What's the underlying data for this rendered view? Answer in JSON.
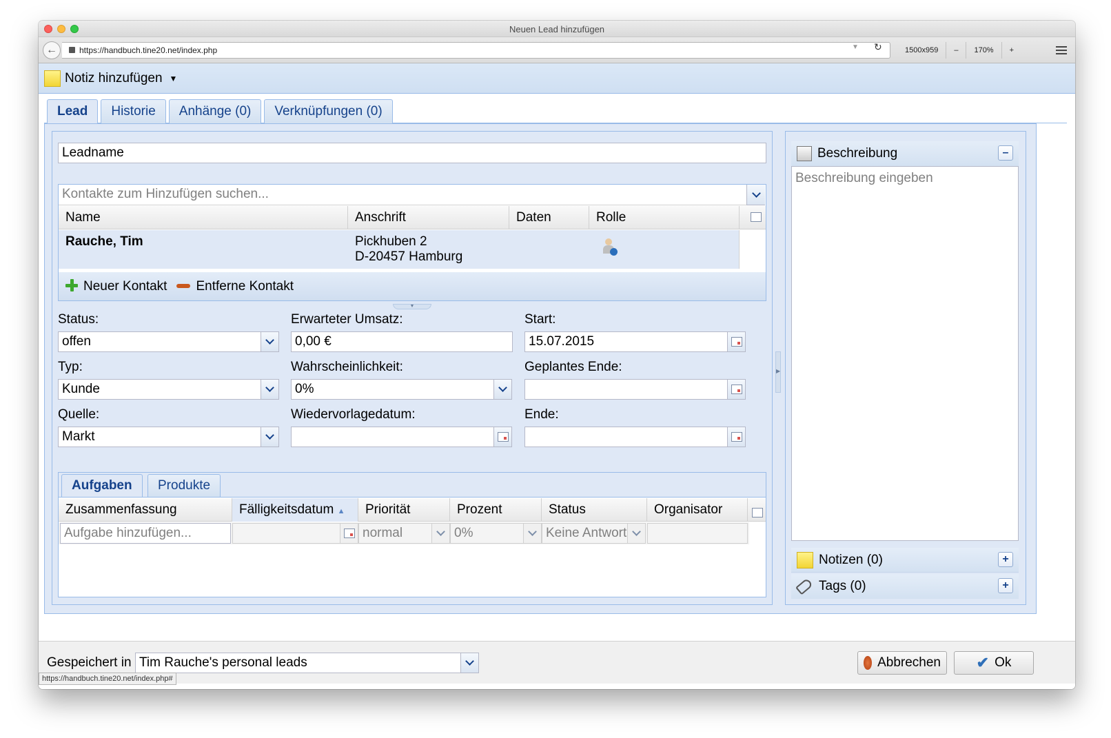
{
  "window": {
    "title": "Neuen Lead hinzufügen",
    "url": "https://handbuch.tine20.net/index.php",
    "viewport": "1500x959",
    "zoom_minus": "–",
    "zoom": "170%",
    "zoom_plus": "+"
  },
  "toolbar": {
    "add_note_label": "Notiz hinzufügen"
  },
  "tabs": [
    {
      "label": "Lead"
    },
    {
      "label": "Historie"
    },
    {
      "label": "Anhänge (0)"
    },
    {
      "label": "Verknüpfungen (0)"
    }
  ],
  "lead": {
    "name_placeholder": "Leadname",
    "contacts_search_placeholder": "Kontakte zum Hinzufügen suchen...",
    "contacts_columns": [
      "Name",
      "Anschrift",
      "Daten",
      "Rolle"
    ],
    "contacts_rows": [
      {
        "name": "Rauche, Tim",
        "address_line1": "Pickhuben 2",
        "address_line2": "D-20457 Hamburg"
      }
    ],
    "new_contact_label": "Neuer Kontakt",
    "remove_contact_label": "Entferne Kontakt",
    "fields": {
      "status_label": "Status:",
      "status_value": "offen",
      "turnover_label": "Erwarteter Umsatz:",
      "turnover_value": "0,00 €",
      "start_label": "Start:",
      "start_value": "15.07.2015",
      "type_label": "Typ:",
      "type_value": "Kunde",
      "probability_label": "Wahrscheinlichkeit:",
      "probability_value": "0%",
      "planned_end_label": "Geplantes Ende:",
      "planned_end_value": "",
      "source_label": "Quelle:",
      "source_value": "Markt",
      "resubmission_label": "Wiedervorlagedatum:",
      "resubmission_value": "",
      "end_label": "Ende:",
      "end_value": ""
    },
    "subtabs": [
      {
        "label": "Aufgaben"
      },
      {
        "label": "Produkte"
      }
    ],
    "tasks_columns": [
      "Zusammenfassung",
      "Fälligkeitsdatum",
      "Priorität",
      "Prozent",
      "Status",
      "Organisator"
    ],
    "task_new_row": {
      "summary_placeholder": "Aufgabe hinzufügen...",
      "priority": "normal",
      "percent": "0%",
      "status": "Keine Antwort"
    }
  },
  "sidebar": {
    "description_title": "Beschreibung",
    "description_placeholder": "Beschreibung eingeben",
    "notes_label": "Notizen (0)",
    "tags_label": "Tags (0)"
  },
  "footer": {
    "saved_in_label": "Gespeichert in",
    "container_value": "Tim Rauche's personal leads",
    "cancel_label": "Abbrechen",
    "ok_label": "Ok",
    "status_url": "https://handbuch.tine20.net/index.php#"
  }
}
